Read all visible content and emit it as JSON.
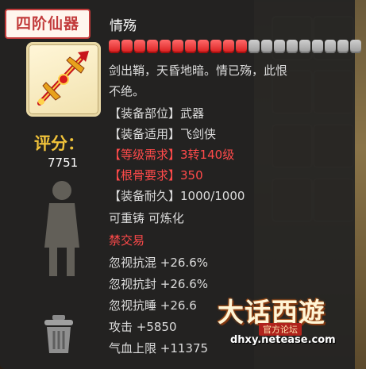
{
  "item": {
    "tier": "四阶仙器",
    "name": "情殇",
    "level_bar": {
      "filled": 11,
      "total": 20
    },
    "description_line1": "剑出鞘，天昏地暗。情已殇，此恨",
    "description_line2": "不绝。",
    "rating_label": "评分：",
    "rating_value": "7751",
    "attributes": [
      {
        "label": "【装备部位】",
        "value": "武器"
      },
      {
        "label": "【装备适用】",
        "value": "飞剑侠"
      },
      {
        "label": "【等级需求】",
        "value": "3转140级"
      },
      {
        "label": "【根骨要求】",
        "value": "350"
      },
      {
        "label": "【装备耐久】",
        "value": "1000/1000"
      }
    ],
    "refine_text": "可重铸 可炼化",
    "trade_text": "禁交易",
    "stats": [
      "忽视抗混 +26.6%",
      "忽视抗封 +26.6%",
      "忽视抗睡 +26.6",
      "攻击 +5850",
      "气血上限 +11375"
    ]
  },
  "logo": {
    "title": "大话西遊",
    "subtitle": "官方论坛",
    "url": "dhxy.netease.com"
  },
  "colors": {
    "panel_bg": "#222222",
    "tier_red": "#c23b3b",
    "highlight_red": "#ff4a4a",
    "rating_gold": "#f0c23a",
    "text_grey": "#dcdcdc"
  },
  "icons": [
    "sword-icon",
    "trash-icon",
    "character-figure"
  ]
}
